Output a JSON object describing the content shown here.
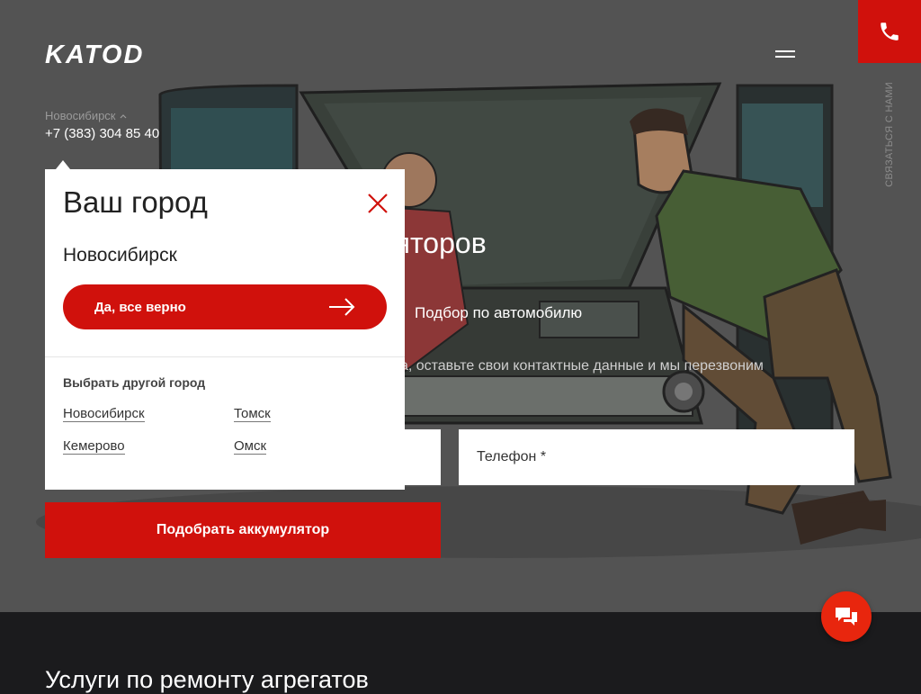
{
  "brand": {
    "logo_text": "KATOD"
  },
  "header": {
    "city": "Новосибирск",
    "phone": "+7 (383) 304 85 40",
    "contact_vertical": "СВЯЗАТЬСЯ С НАМИ"
  },
  "hero": {
    "title_visible": "ляторов",
    "tab_auto": "Подбор по автомобилю",
    "subtitle_visible": "тора, оставьте свои контактные данные и мы перезвоним",
    "phone_placeholder": "Телефон *",
    "submit_label": "Подобрать аккумулятор"
  },
  "city_popup": {
    "title": "Ваш город",
    "detected_city": "Новосибирск",
    "confirm_label": "Да, все верно",
    "other_title": "Выбрать другой город",
    "cities": [
      "Новосибирск",
      "Томск",
      "Кемерово",
      "Омск"
    ]
  },
  "services": {
    "title": "Услуги по ремонту агрегатов"
  },
  "colors": {
    "accent": "#d0110c",
    "chat": "#e8260e",
    "dark": "#1b1b1d"
  },
  "icons": {
    "call": "phone-icon",
    "menu": "hamburger-icon",
    "close": "close-icon",
    "arrow": "arrow-right-icon",
    "chat": "chat-icon",
    "chevron": "chevron-up-icon"
  }
}
